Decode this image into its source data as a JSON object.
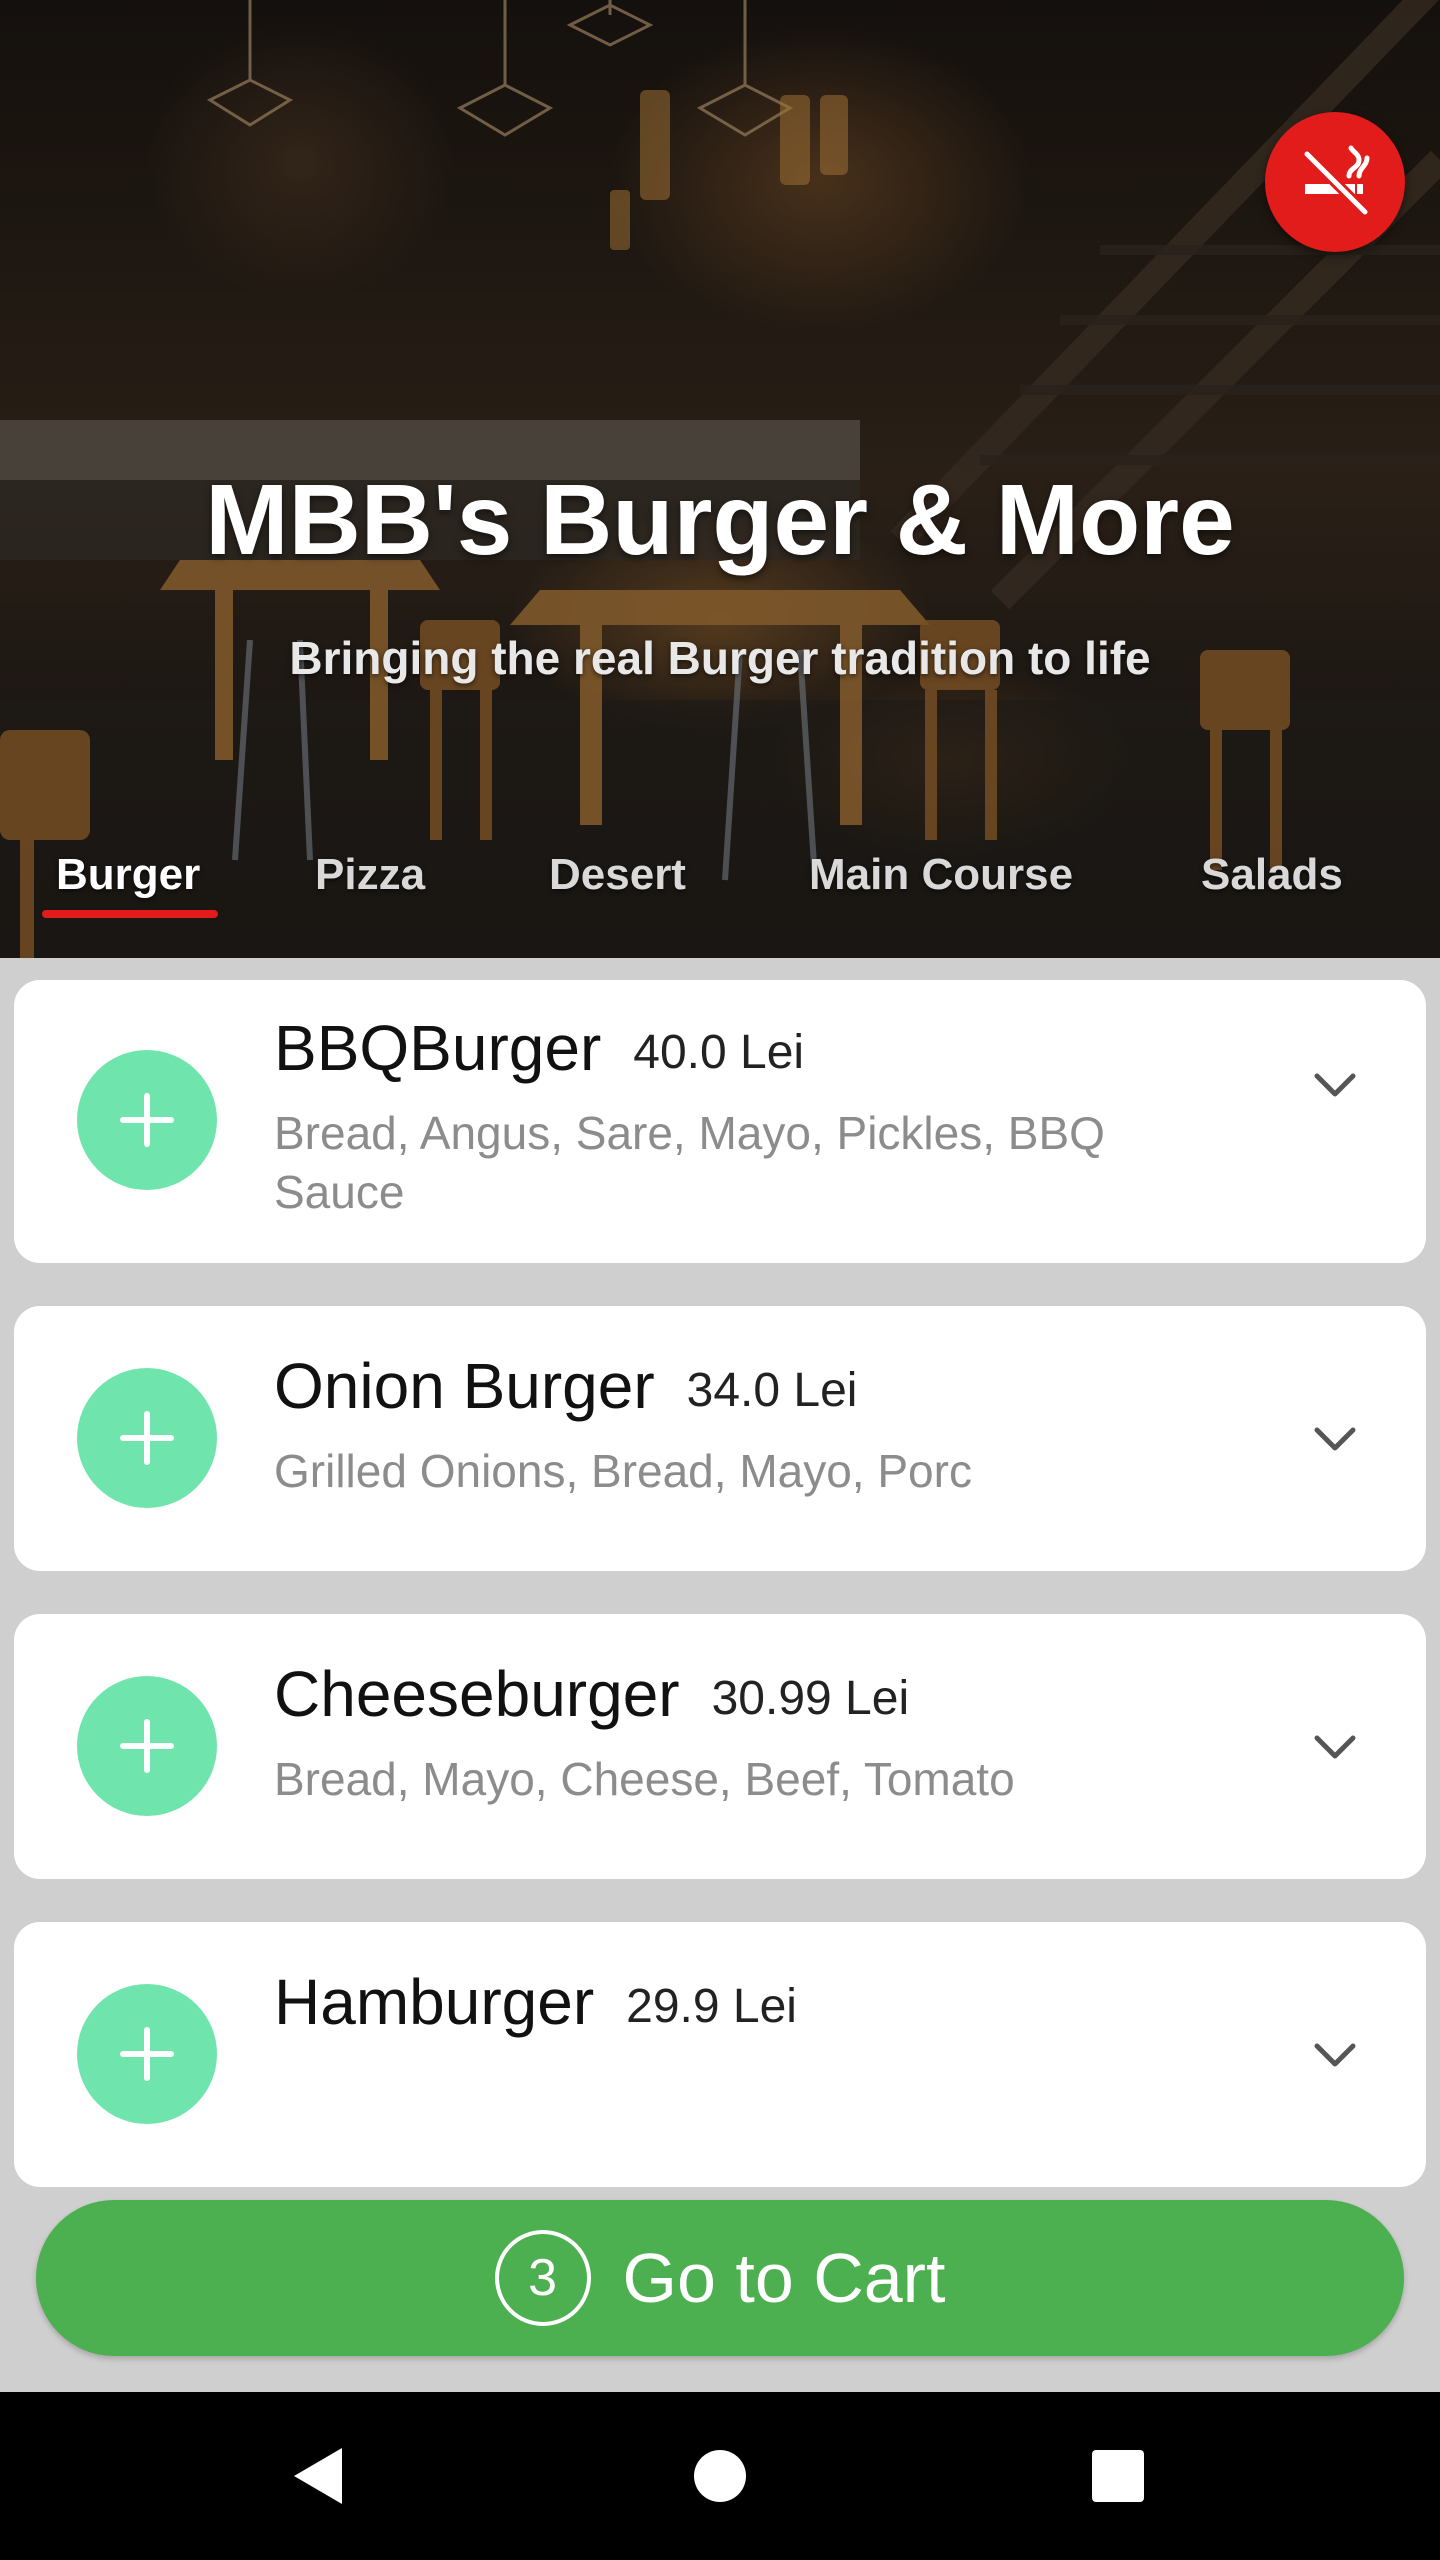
{
  "hero": {
    "title": "MBB's Burger & More",
    "tagline": "Bringing the real Burger tradition to life",
    "no_smoking_icon": "no-smoking-icon",
    "no_smoking_color": "#e21b1b"
  },
  "tabs": [
    {
      "label": "Burger",
      "active": true
    },
    {
      "label": "Pizza",
      "active": false
    },
    {
      "label": "Desert",
      "active": false
    },
    {
      "label": "Main Course",
      "active": false
    },
    {
      "label": "Salads",
      "active": false
    }
  ],
  "items": [
    {
      "name": "BBQBurger",
      "price": "40.0 Lei",
      "description": "Bread, Angus, Sare, Mayo, Pickles, BBQ Sauce"
    },
    {
      "name": "Onion Burger",
      "price": "34.0 Lei",
      "description": "Grilled Onions, Bread, Mayo, Porc"
    },
    {
      "name": "Cheeseburger",
      "price": "30.99 Lei",
      "description": "Bread, Mayo, Cheese, Beef, Tomato"
    },
    {
      "name": "Hamburger",
      "price": "29.9 Lei",
      "description": ""
    }
  ],
  "cart": {
    "count": "3",
    "label": "Go to Cart"
  },
  "colors": {
    "accent_red": "#e21b1b",
    "add_button": "#6fe5ad",
    "cart_green": "#4caf50"
  },
  "nav": {
    "back_icon": "back-triangle-icon",
    "home_icon": "home-circle-icon",
    "recents_icon": "recents-square-icon"
  }
}
